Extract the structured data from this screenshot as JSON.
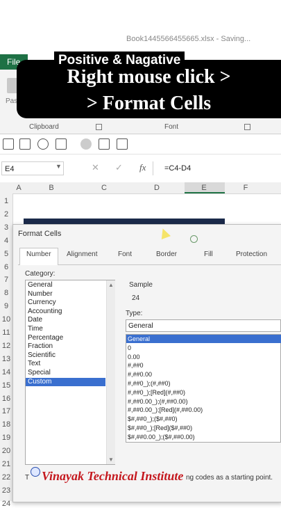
{
  "window": {
    "doc_title": "Book1445566455665.xlsx - Saving..."
  },
  "ribbon": {
    "file_tab": "File",
    "paste_label": "Pas",
    "clipboard_label": "Clipboard",
    "font_label": "Font"
  },
  "captions": {
    "small": "Positive & Nagative",
    "big_line1": "Right mouse click >",
    "big_line2": "> Format Cells"
  },
  "formula_bar": {
    "name_box": "E4",
    "fx": "fx",
    "formula": "=C4-D4"
  },
  "grid": {
    "columns": [
      "A",
      "B",
      "C",
      "D",
      "E",
      "F"
    ],
    "rows": [
      "1",
      "2",
      "3",
      "4",
      "5",
      "6",
      "7",
      "8",
      "9",
      "10",
      "11",
      "12",
      "13",
      "14",
      "15",
      "16",
      "17",
      "18",
      "19",
      "20",
      "21",
      "22",
      "23",
      "24"
    ]
  },
  "dialog": {
    "title": "Format Cells",
    "tabs": [
      "Number",
      "Alignment",
      "Font",
      "Border",
      "Fill",
      "Protection"
    ],
    "category_label": "Category:",
    "categories": [
      "General",
      "Number",
      "Currency",
      "Accounting",
      "Date",
      "Time",
      "Percentage",
      "Fraction",
      "Scientific",
      "Text",
      "Special",
      "Custom"
    ],
    "selected_category": "Custom",
    "sample_label": "Sample",
    "sample_value": "24",
    "type_label": "Type:",
    "type_value": "General",
    "types": [
      "General",
      "0",
      "0.00",
      "#,##0",
      "#,##0.00",
      "#,##0_);(#,##0)",
      "#,##0_);[Red](#,##0)",
      "#,##0.00_);(#,##0.00)",
      "#,##0.00_);[Red](#,##0.00)",
      "$#,##0_);($#,##0)",
      "$#,##0_);[Red]($#,##0)",
      "$#,##0.00_);($#,##0.00)"
    ],
    "bottom_left": "T",
    "bottom_right": "ng codes as a starting point."
  },
  "watermark": "Vinayak Technical Institute",
  "colors": {
    "excel_green": "#1e7145",
    "selection_blue": "#3a6fcf",
    "watermark_red": "#c4161c"
  }
}
